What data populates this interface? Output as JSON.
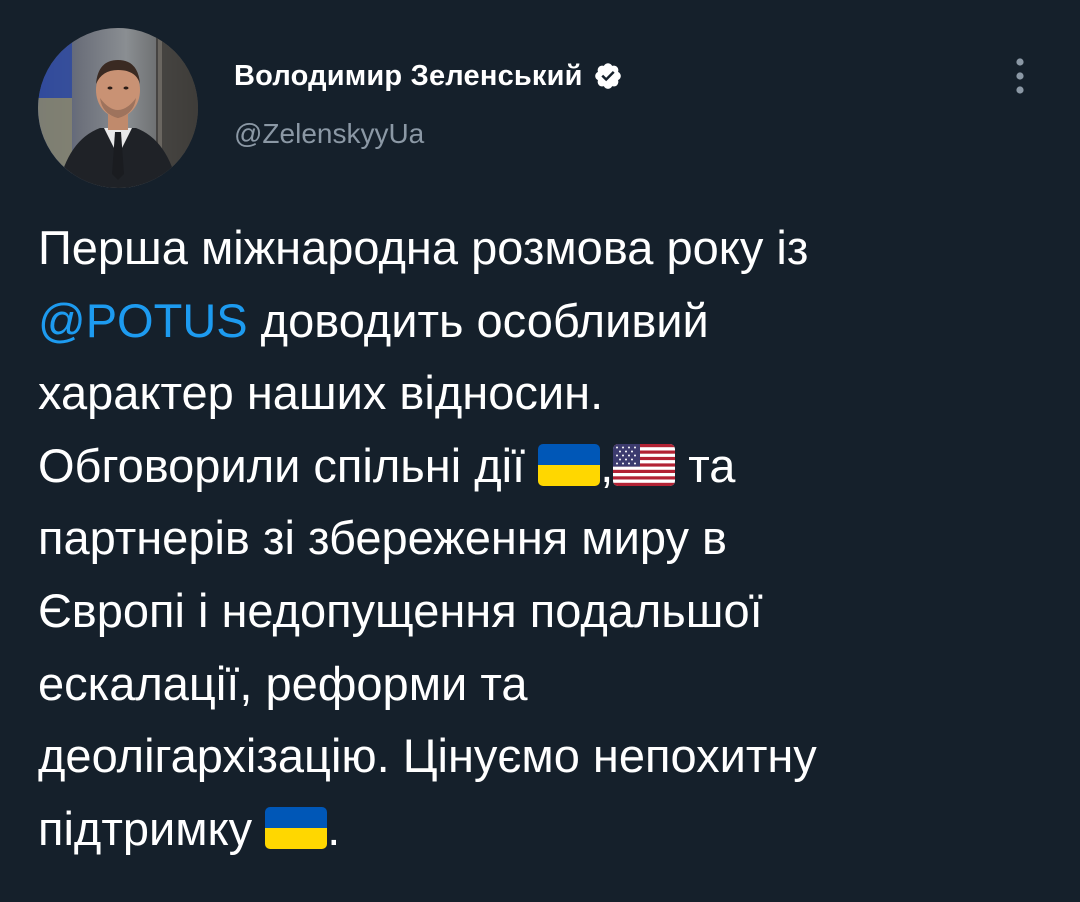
{
  "tweet": {
    "author": {
      "display_name": "Володимир Зеленський",
      "handle": "@ZelenskyyUa",
      "verified_icon": "verified-badge-icon",
      "avatar": "avatar-photo"
    },
    "menu_icon": "more-vertical-icon",
    "body": {
      "line1": "Перша міжнародна розмова року із",
      "mention": "@POTUS",
      "line2_rest": " доводить особливий",
      "line3": "характер наших відносин.",
      "line4_before": "Обговорили спільні дії ",
      "flag_ua_1": "flag-ukraine-icon",
      "comma": ",",
      "flag_us": "flag-usa-icon",
      "line4_after": " та",
      "line5": "партнерів зі збереження миру в",
      "line6": "Європі і недопущення подальшої",
      "line7": "ескалації, реформи та",
      "line8": "деолігархізацію. Цінуємо непохитну",
      "line9_before": "підтримку ",
      "flag_ua_2": "flag-ukraine-icon",
      "line9_after": "."
    },
    "colors": {
      "background": "#15202b",
      "text": "#ffffff",
      "secondary_text": "#8b98a5",
      "link": "#1d9bf0"
    }
  }
}
